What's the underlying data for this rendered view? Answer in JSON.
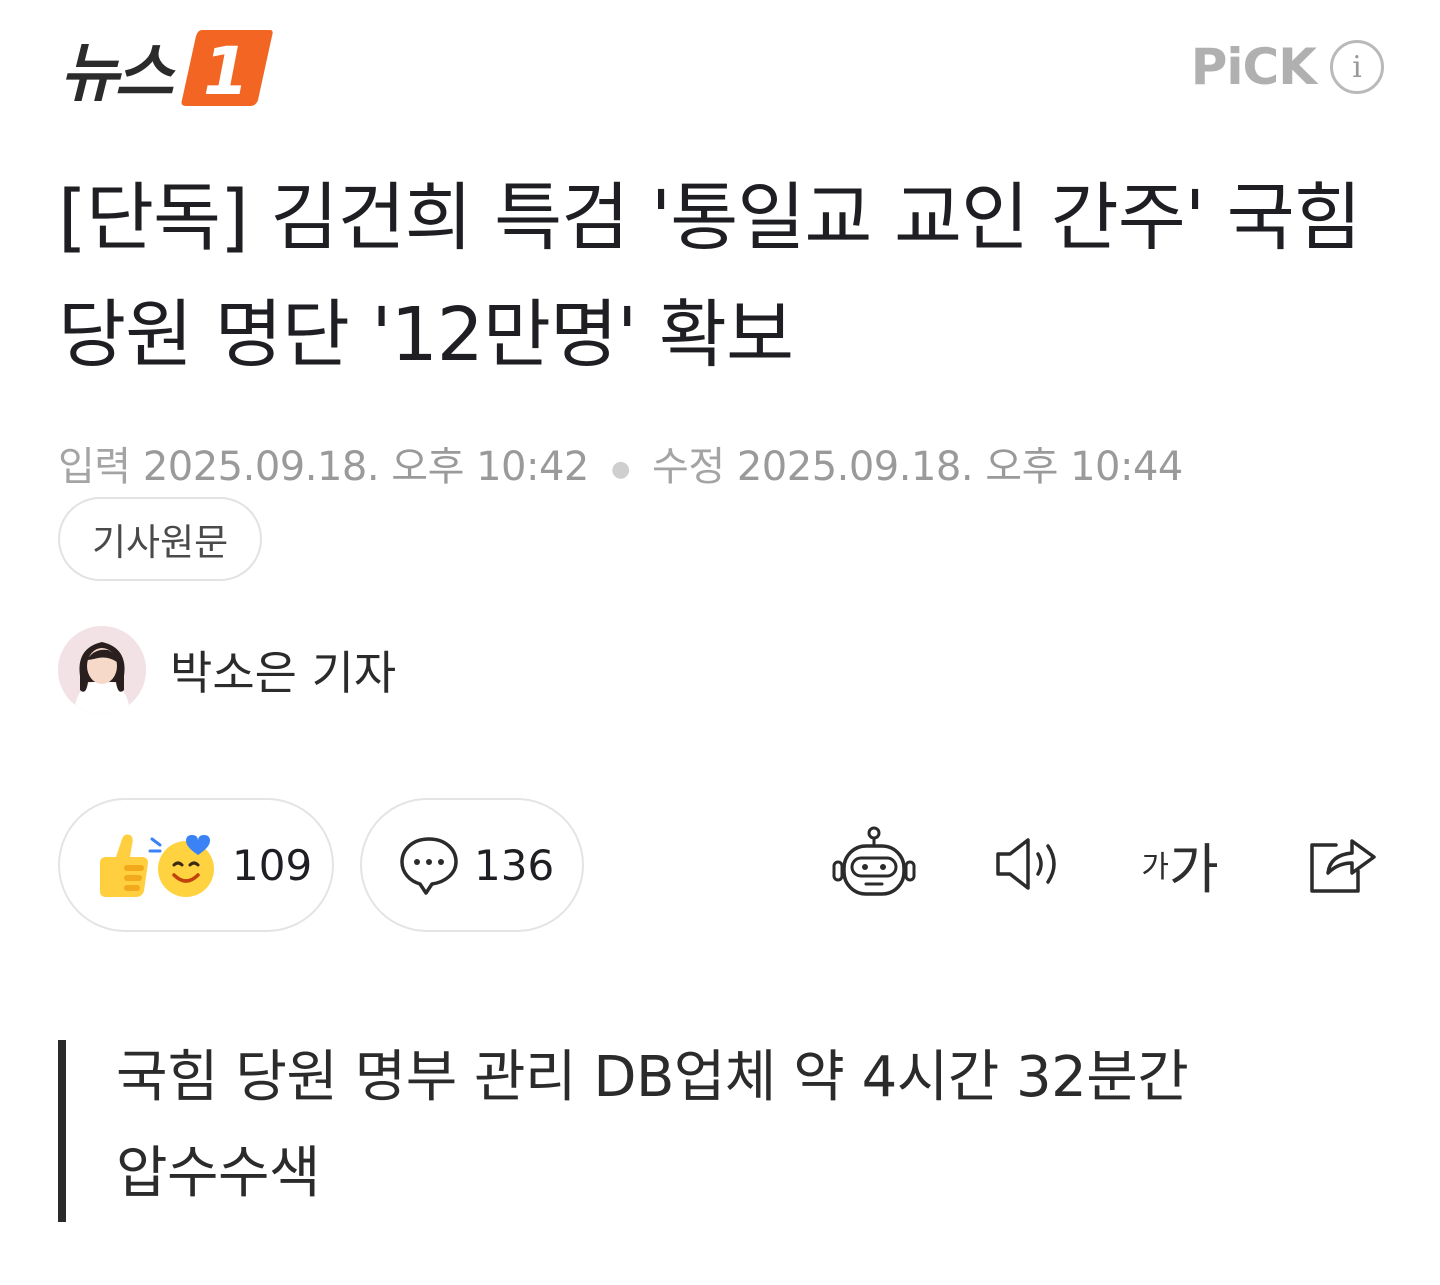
{
  "header": {
    "logo_text": "뉴스",
    "logo_badge": "1",
    "pick_label": "PiCK",
    "info_label": "i"
  },
  "article": {
    "title": "[단독] 김건희 특검 '통일교 교인 간주' 국힘 당원 명단 '12만명' 확보",
    "input_label": "입력",
    "input_time": "2025.09.18. 오후 10:42",
    "modified_label": "수정",
    "modified_time": "2025.09.18. 오후 10:44",
    "original_button": "기사원문",
    "reporter": "박소은 기자",
    "subtitle": "국힘 당원 명부 관리 DB업체 약 4시간 32분간 압수수색"
  },
  "reactions": {
    "like_count": "109",
    "comment_count": "136"
  },
  "tools": {
    "font_small": "가",
    "font_big": "가"
  },
  "colors": {
    "brand_orange": "#f26522",
    "text_primary": "#1e1e23",
    "meta_gray": "#9a9a9a",
    "emoji_yellow": "#ffd23f",
    "heart_blue": "#3b82f6"
  }
}
